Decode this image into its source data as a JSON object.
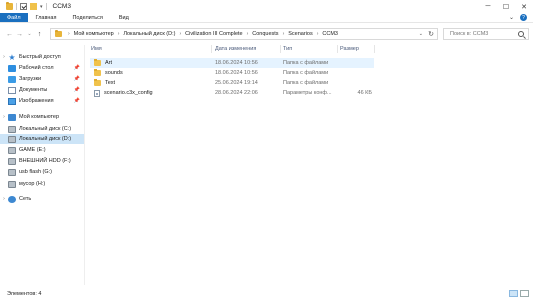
{
  "window": {
    "title": "CCM3"
  },
  "ribbon": {
    "tabs": [
      "Файл",
      "Главная",
      "Поделиться",
      "Вид"
    ]
  },
  "address": {
    "crumbs": [
      "Мой компьютер",
      "Локальный диск (D:)",
      "Civilization III Complete",
      "Conquests",
      "Scenarios",
      "CCM3"
    ],
    "search_placeholder": "Поиск в: CCM3"
  },
  "nav": {
    "items": [
      {
        "label": "Быстрый доступ",
        "icon": "star-icon",
        "expandable": true
      },
      {
        "label": "Рабочий стол",
        "icon": "desktop-icon",
        "pinned": true
      },
      {
        "label": "Загрузки",
        "icon": "downloads-icon",
        "pinned": true
      },
      {
        "label": "Документы",
        "icon": "documents-icon",
        "pinned": true
      },
      {
        "label": "Изображения",
        "icon": "pictures-icon",
        "pinned": true
      },
      {
        "label": "Мой компьютер",
        "icon": "computer-icon",
        "expandable": true
      },
      {
        "label": "Локальный диск (C:)",
        "icon": "drive-icon"
      },
      {
        "label": "Локальный диск (D:)",
        "icon": "drive-icon",
        "selected": true
      },
      {
        "label": "GAME (E:)",
        "icon": "drive-icon"
      },
      {
        "label": "ВНЕШНИЙ HDD (F:)",
        "icon": "drive-icon"
      },
      {
        "label": "usb flash (G:)",
        "icon": "drive-icon"
      },
      {
        "label": "мусор (H:)",
        "icon": "drive-icon"
      },
      {
        "label": "Сеть",
        "icon": "network-icon",
        "expandable": true
      }
    ]
  },
  "files": {
    "columns": {
      "name": "Имя",
      "date": "Дата изменения",
      "type": "Тип",
      "size": "Размер"
    },
    "rows": [
      {
        "name": "Art",
        "date": "18.06.2024 10:56",
        "type": "Папка с файлами",
        "size": "",
        "kind": "folder"
      },
      {
        "name": "sounds",
        "date": "18.06.2024 10:56",
        "type": "Папка с файлами",
        "size": "",
        "kind": "folder"
      },
      {
        "name": "Text",
        "date": "25.06.2024 19:14",
        "type": "Папка с файлами",
        "size": "",
        "kind": "folder"
      },
      {
        "name": "scenario.c3x_config",
        "date": "28.06.2024 22:06",
        "type": "Параметры конф...",
        "size": "46 КБ",
        "kind": "file"
      }
    ]
  },
  "status": {
    "items_text": "Элементов: 4"
  }
}
